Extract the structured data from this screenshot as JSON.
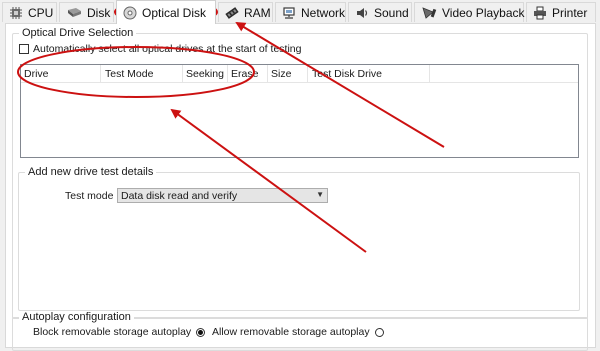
{
  "tabs": [
    {
      "id": "cpu",
      "label": "CPU",
      "icon": "cpu-icon"
    },
    {
      "id": "disk",
      "label": "Disk",
      "icon": "disk-icon"
    },
    {
      "id": "optical",
      "label": "Optical Disk",
      "icon": "optical-disk-icon",
      "active": true
    },
    {
      "id": "ram",
      "label": "RAM",
      "icon": "ram-icon"
    },
    {
      "id": "network",
      "label": "Network",
      "icon": "network-icon"
    },
    {
      "id": "sound",
      "label": "Sound",
      "icon": "sound-icon"
    },
    {
      "id": "video",
      "label": "Video Playback",
      "icon": "video-playback-icon"
    },
    {
      "id": "printer",
      "label": "Printer",
      "icon": "printer-icon"
    }
  ],
  "optical_selection": {
    "title": "Optical Drive Selection",
    "auto_select_label": "Automatically select all optical drives at the start of testing",
    "auto_select_checked": false,
    "columns": [
      "Drive",
      "Test Mode",
      "Seeking",
      "Erase",
      "Size",
      "Test Disk Drive"
    ]
  },
  "add_drive": {
    "title": "Add new drive test details",
    "test_mode_label": "Test mode",
    "test_mode_value": "Data disk read and verify"
  },
  "autoplay": {
    "title": "Autoplay configuration",
    "block_label": "Block removable storage autoplay",
    "block_selected": true,
    "allow_label": "Allow removable storage autoplay",
    "allow_selected": false
  },
  "annotation_color": "#cc1111"
}
